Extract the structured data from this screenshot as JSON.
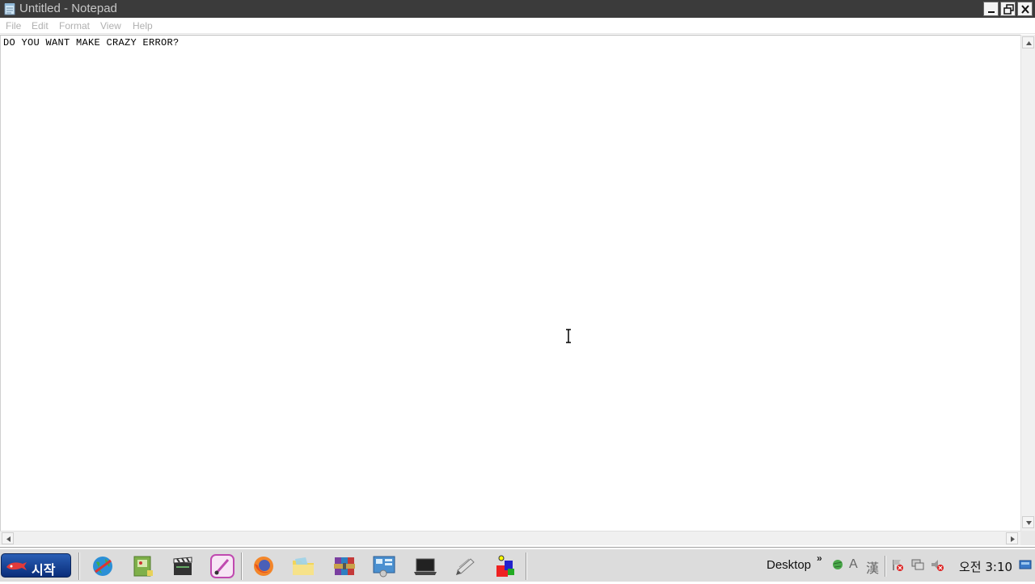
{
  "window": {
    "title": "Untitled - Notepad",
    "icon": "notepad-icon"
  },
  "menu": [
    {
      "label": "File"
    },
    {
      "label": "Edit"
    },
    {
      "label": "Format"
    },
    {
      "label": "View"
    },
    {
      "label": "Help"
    }
  ],
  "document": {
    "text": "DO YOU WANT MAKE CRAZY ERROR?"
  },
  "taskbar": {
    "start_label": "시작",
    "quicklaunch": [
      "globe-icon",
      "folder-map-icon",
      "clapperboard-icon",
      "paint-icon",
      "firefox-icon",
      "folder-icon",
      "winrar-icon",
      "control-panel-icon",
      "laptop-icon",
      "pen-icon",
      "shapes-icon"
    ],
    "toolbar_label": "Desktop",
    "toolbar_chevron": "»",
    "ime_a": "A",
    "ime_hanja": "漢",
    "clock": "오전 3:10"
  },
  "colors": {
    "titlebar": "#3b3b3b",
    "start_button": "#1a4a9a",
    "taskbar": "#dcdcdc"
  }
}
